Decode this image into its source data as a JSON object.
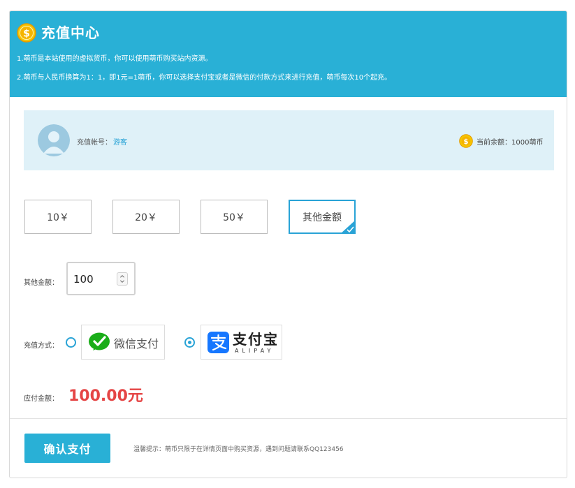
{
  "header": {
    "title": "充值中心",
    "note1": "1.萌币是本站使用的虚拟货币，你可以使用萌币购买站内资源。",
    "note2": "2.萌币与人民币换算为1：1，即1元=1萌币，你可以选择支付宝或者是微信的付款方式来进行充值，萌币每次10个起充。"
  },
  "account": {
    "label": "充值帐号：",
    "value": "游客",
    "balance_label": "当前余额：",
    "balance_value": "1000萌币"
  },
  "amount_options": [
    {
      "label": "10￥",
      "selected": false
    },
    {
      "label": "20￥",
      "selected": false
    },
    {
      "label": "50￥",
      "selected": false
    },
    {
      "label": "其他金额",
      "selected": true
    }
  ],
  "other_amount": {
    "label": "其他金额：",
    "value": "100"
  },
  "payment": {
    "label": "充值方式：",
    "wechat_label": "微信支付",
    "alipay_label": "支付宝",
    "alipay_en": "ALIPAY",
    "selected": "alipay"
  },
  "due": {
    "label": "应付金额：",
    "value": "100.00元"
  },
  "footer": {
    "confirm_label": "确认支付",
    "tip": "温馨提示：萌币只限于在详情页面中购买资源，遇到问题请联系QQ123456"
  },
  "colors": {
    "primary": "#29b0d6",
    "account_bg": "#dff1f8",
    "price_red": "#e54545",
    "wechat_green": "#1aad19",
    "alipay_blue": "#1677ff",
    "coin_gold": "#f5b400"
  }
}
